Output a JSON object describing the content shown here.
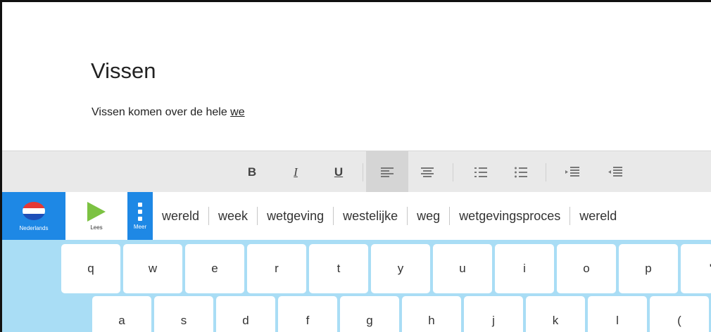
{
  "document": {
    "title": "Vissen",
    "text_before": "Vissen komen over de hele ",
    "current_word": "we"
  },
  "toolbar": {
    "bold_label": "B",
    "italic_label": "I",
    "underline_label": "U"
  },
  "strip": {
    "language_label": "Nederlands",
    "read_label": "Lees",
    "more_label": "Meer",
    "suggestions": [
      "wereld",
      "week",
      "wetgeving",
      "westelijke",
      "weg",
      "wetgevingsproces",
      "wereld"
    ]
  },
  "keyboard": {
    "row1": [
      "q",
      "w",
      "e",
      "r",
      "t",
      "y",
      "u",
      "i",
      "o",
      "p",
      "'"
    ],
    "row2": [
      "a",
      "s",
      "d",
      "f",
      "g",
      "h",
      "j",
      "k",
      "l",
      "("
    ]
  },
  "colors": {
    "accent_blue": "#1e88e5",
    "keyboard_bg": "#a9ddf5",
    "play_green": "#7cc242",
    "flag_red": "#e53935"
  }
}
